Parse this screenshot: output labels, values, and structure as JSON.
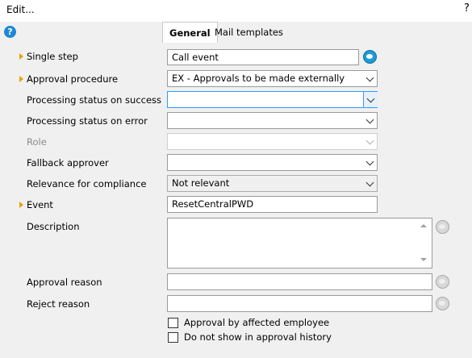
{
  "window": {
    "title": "Edit...",
    "help_char": "?"
  },
  "help_icon_char": "?",
  "tabs": [
    {
      "label": "General",
      "active": true
    },
    {
      "label": "Mail templates",
      "active": false
    }
  ],
  "form": {
    "single_step": {
      "label": "Single step",
      "value": "Call event"
    },
    "approval_procedure": {
      "label": "Approval procedure",
      "value": "EX - Approvals to be made externally"
    },
    "processing_status_success": {
      "label": "Processing status on success",
      "value": ""
    },
    "processing_status_error": {
      "label": "Processing status on error",
      "value": ""
    },
    "role": {
      "label": "Role",
      "value": ""
    },
    "fallback_approver": {
      "label": "Fallback approver",
      "value": ""
    },
    "relevance_compliance": {
      "label": "Relevance for compliance",
      "value": "Not relevant"
    },
    "event": {
      "label": "Event",
      "value": "ResetCentralPWD"
    },
    "description": {
      "label": "Description",
      "value": ""
    },
    "approval_reason": {
      "label": "Approval reason",
      "value": ""
    },
    "reject_reason": {
      "label": "Reject reason",
      "value": ""
    },
    "approval_by_affected": {
      "label": "Approval by affected employee",
      "checked": false
    },
    "do_not_show_history": {
      "label": "Do not show in approval history",
      "checked": false
    }
  },
  "colors": {
    "accent_blue": "#1e88d6",
    "required_marker": "#e8a200",
    "focus_border": "#3399ff"
  }
}
